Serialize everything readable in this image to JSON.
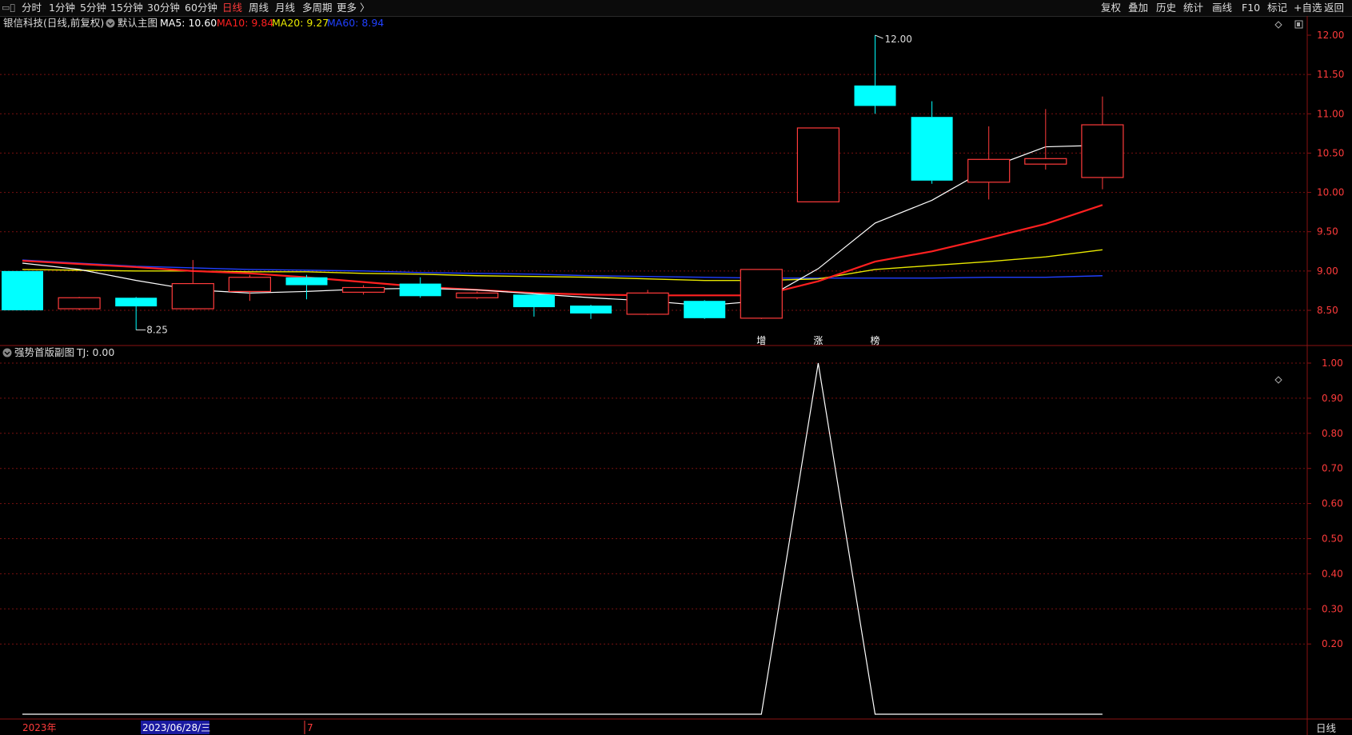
{
  "toolbar": {
    "periods": [
      "分时",
      "1分钟",
      "5分钟",
      "15分钟",
      "30分钟",
      "60分钟",
      "日线",
      "周线",
      "月线",
      "多周期",
      "更多 〉"
    ],
    "active_period": "日线",
    "right_buttons": [
      "复权",
      "叠加",
      "历史",
      "统计",
      "画线",
      "F10",
      "标记",
      "+自选",
      "返回"
    ]
  },
  "main_panel": {
    "title": "银信科技(日线,前复权)",
    "chart_name": "默认主图",
    "ma_labels": [
      {
        "text": "MA5: 10.60",
        "color": "#ffffff"
      },
      {
        "text": "MA10: 9.84",
        "color": "#ff2020"
      },
      {
        "text": "MA20: 9.27",
        "color": "#e8e800"
      },
      {
        "text": "MA60: 8.94",
        "color": "#2040ff"
      }
    ],
    "high_label": "12.00",
    "low_label": "8.25",
    "signal_chars": [
      "增",
      "涨",
      "榜"
    ]
  },
  "sub_panel": {
    "title": "强势首版副图",
    "value_label": "TJ: 0.00"
  },
  "axis": {
    "main_ticks": [
      "12.00",
      "11.50",
      "11.00",
      "10.50",
      "10.00",
      "9.50",
      "9.00",
      "8.50"
    ],
    "sub_ticks": [
      "1.00",
      "0.90",
      "0.80",
      "0.70",
      "0.60",
      "0.50",
      "0.40",
      "0.30",
      "0.20"
    ],
    "period_label": "日线"
  },
  "footer": {
    "year": "2023年",
    "cursor_date": "2023/06/28/三",
    "month": "7"
  },
  "colors": {
    "up": "#ff3b3b",
    "down": "#00ffff",
    "ma5": "#ffffff",
    "ma10": "#ff2020",
    "ma20": "#e8e800",
    "ma60": "#2040ff",
    "grid": "#7a1010"
  },
  "chart_data": [
    {
      "type": "candlestick",
      "title": "银信科技(日线,前复权)",
      "ylim": [
        8.2,
        12.1
      ],
      "candles": [
        {
          "open": 9.0,
          "close": 8.5,
          "high": 9.0,
          "low": 8.5
        },
        {
          "open": 8.52,
          "close": 8.66,
          "high": 8.67,
          "low": 8.5
        },
        {
          "open": 8.66,
          "close": 8.55,
          "high": 8.67,
          "low": 8.25
        },
        {
          "open": 8.52,
          "close": 8.84,
          "high": 9.14,
          "low": 8.5
        },
        {
          "open": 8.74,
          "close": 8.92,
          "high": 8.95,
          "low": 8.62
        },
        {
          "open": 8.92,
          "close": 8.82,
          "high": 8.95,
          "low": 8.64
        },
        {
          "open": 8.73,
          "close": 8.79,
          "high": 8.82,
          "low": 8.7
        },
        {
          "open": 8.84,
          "close": 8.68,
          "high": 8.92,
          "low": 8.66
        },
        {
          "open": 8.66,
          "close": 8.72,
          "high": 8.74,
          "low": 8.64
        },
        {
          "open": 8.7,
          "close": 8.54,
          "high": 8.71,
          "low": 8.42
        },
        {
          "open": 8.56,
          "close": 8.46,
          "high": 8.57,
          "low": 8.39
        },
        {
          "open": 8.45,
          "close": 8.72,
          "high": 8.76,
          "low": 8.44
        },
        {
          "open": 8.62,
          "close": 8.4,
          "high": 8.63,
          "low": 8.39
        },
        {
          "open": 8.4,
          "close": 9.02,
          "high": 9.02,
          "low": 8.39
        },
        {
          "open": 9.88,
          "close": 10.82,
          "high": 10.82,
          "low": 9.88
        },
        {
          "open": 11.36,
          "close": 11.1,
          "high": 12.0,
          "low": 11.0
        },
        {
          "open": 10.96,
          "close": 10.15,
          "high": 11.16,
          "low": 10.11
        },
        {
          "open": 10.13,
          "close": 10.42,
          "high": 10.84,
          "low": 9.91
        },
        {
          "open": 10.36,
          "close": 10.43,
          "high": 11.06,
          "low": 10.29
        },
        {
          "open": 10.19,
          "close": 10.86,
          "high": 11.22,
          "low": 10.04
        }
      ],
      "series": [
        {
          "name": "MA5",
          "values": [
            9.1,
            9.02,
            8.88,
            8.76,
            8.72,
            8.74,
            8.77,
            8.78,
            8.76,
            8.71,
            8.66,
            8.62,
            8.56,
            8.62,
            9.03,
            9.61,
            9.9,
            10.31,
            10.58,
            10.6
          ]
        },
        {
          "name": "MA10",
          "values": [
            9.13,
            9.09,
            9.05,
            9.0,
            8.97,
            8.92,
            8.86,
            8.8,
            8.76,
            8.72,
            8.7,
            8.69,
            8.69,
            8.69,
            8.87,
            9.12,
            9.25,
            9.42,
            9.6,
            9.84
          ]
        },
        {
          "name": "MA20",
          "values": [
            9.02,
            9.01,
            9.0,
            9.0,
            8.99,
            8.99,
            8.97,
            8.96,
            8.94,
            8.93,
            8.92,
            8.9,
            8.88,
            8.88,
            8.9,
            9.02,
            9.07,
            9.12,
            9.18,
            9.27
          ]
        },
        {
          "name": "MA60",
          "values": [
            9.14,
            9.1,
            9.06,
            9.04,
            9.02,
            9.01,
            9.0,
            8.98,
            8.97,
            8.96,
            8.94,
            8.93,
            8.92,
            8.91,
            8.91,
            8.91,
            8.91,
            8.92,
            8.92,
            8.94
          ]
        }
      ]
    },
    {
      "type": "line",
      "title": "强势首版副图",
      "ylim": [
        0,
        1.0
      ],
      "series": [
        {
          "name": "TJ",
          "values": [
            0,
            0,
            0,
            0,
            0,
            0,
            0,
            0,
            0,
            0,
            0,
            0,
            0,
            0,
            1,
            0,
            0,
            0,
            0,
            0
          ]
        }
      ]
    }
  ]
}
